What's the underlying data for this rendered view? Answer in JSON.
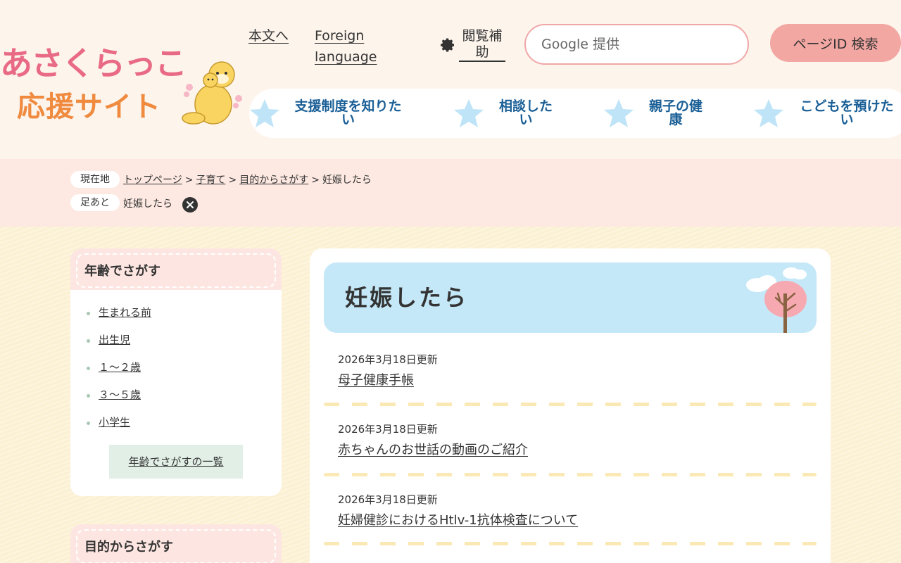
{
  "logo": {
    "line1": "あさくらっこ",
    "line2": "応援サイト"
  },
  "header": {
    "skip_link": "本文へ",
    "foreign_link": "Foreign language",
    "assist_label": "閲覧補助",
    "search_placeholder": "Google 提供",
    "pageid_button": "ページID 検索"
  },
  "gnav": [
    {
      "label": "支援制度を知りたい"
    },
    {
      "label": "相談したい"
    },
    {
      "label": "親子の健康"
    },
    {
      "label": "こどもを預けたい"
    }
  ],
  "breadcrumb": {
    "current_label": "現在地",
    "items": [
      "トップページ",
      "子育て",
      "目的からさがす"
    ],
    "current": "妊娠したら",
    "history_label": "足あと",
    "history_item": "妊娠したら"
  },
  "sidebar": {
    "title": "年齢でさがす",
    "items": [
      "生まれる前",
      "出生児",
      "１～２歳",
      "３～５歳",
      "小学生"
    ],
    "more": "年齢でさがすの一覧",
    "second_title": "目的からさがす"
  },
  "main": {
    "title": "妊娠したら",
    "articles": [
      {
        "date": "2026年3月18日更新",
        "title": "母子健康手帳"
      },
      {
        "date": "2026年3月18日更新",
        "title": "赤ちゃんのお世話の動画のご紹介"
      },
      {
        "date": "2026年3月18日更新",
        "title": "妊婦健診におけるHtlv-1抗体検査について"
      }
    ]
  },
  "colors": {
    "header_bg": "#fdf4ec",
    "nav_text": "#1a5f96",
    "star": "#bfe4f7",
    "accent_pink": "#f3a7a2",
    "title_bg": "#c5e8f8"
  }
}
